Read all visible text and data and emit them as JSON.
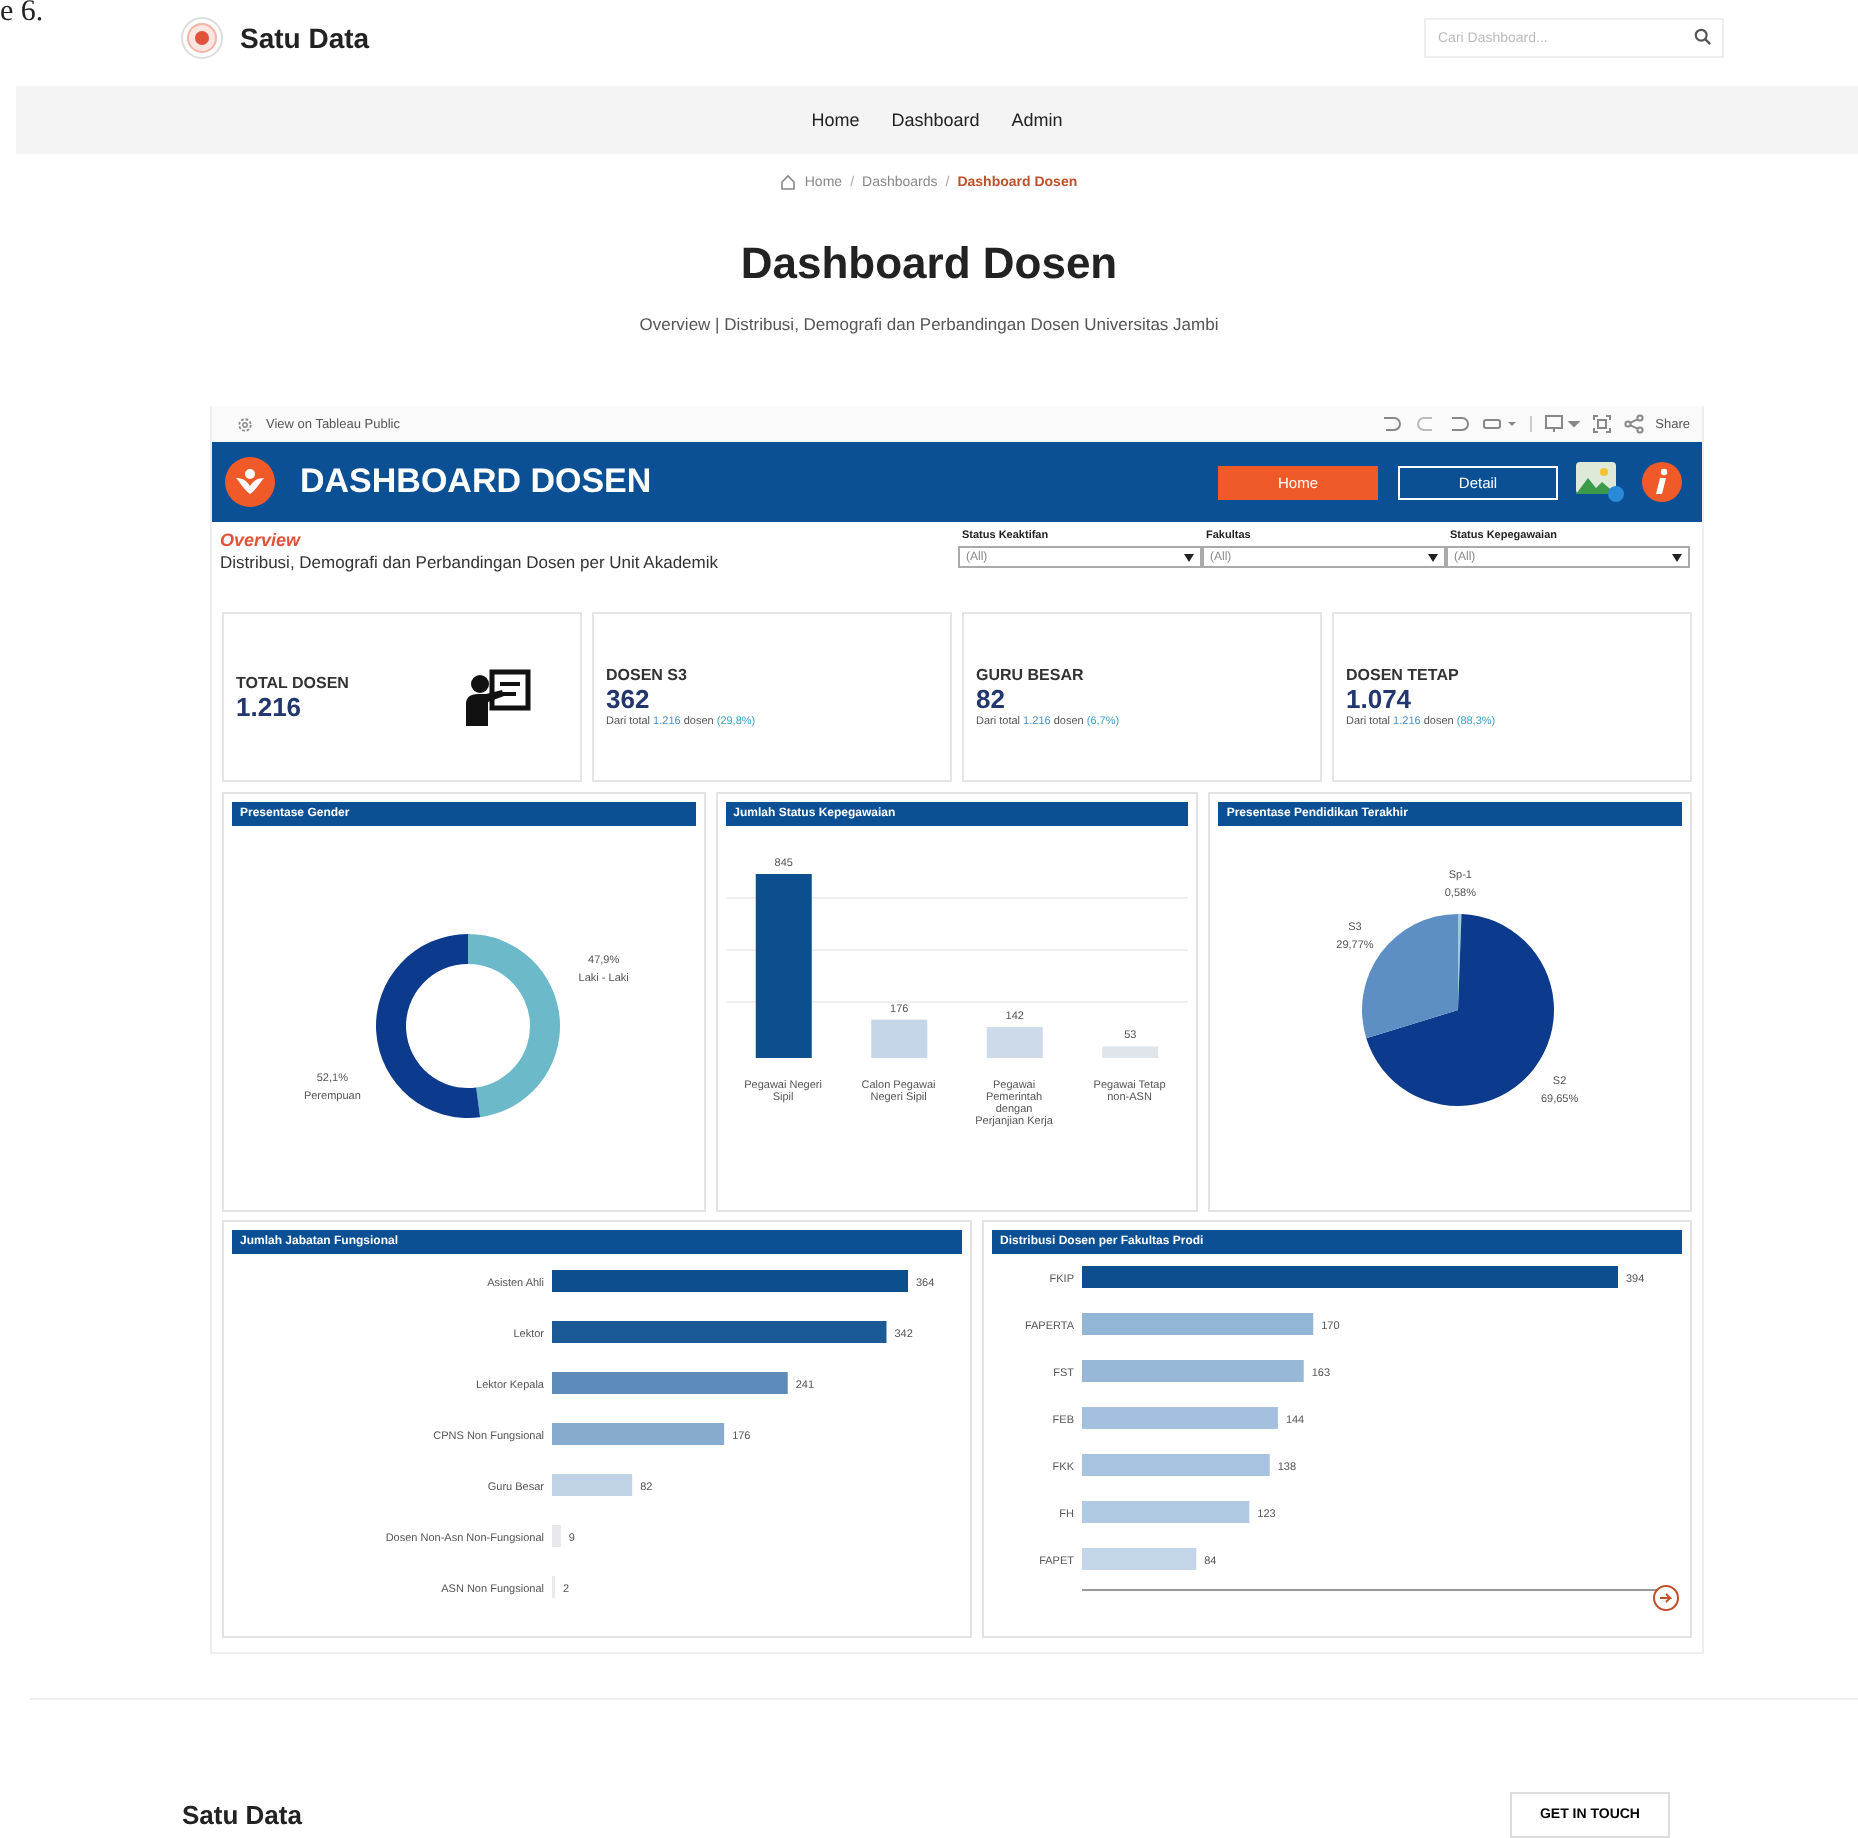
{
  "corner_text": "e 6.",
  "site": {
    "name": "Satu Data",
    "search": {
      "placeholder": "Cari Dashboard..."
    }
  },
  "nav": [
    "Home",
    "Dashboard",
    "Admin"
  ],
  "breadcrumb": {
    "separator": "/",
    "items": [
      {
        "label": "Home",
        "current": false
      },
      {
        "label": "Dashboards",
        "current": false
      },
      {
        "label": "Dashboard Dosen",
        "current": true
      }
    ]
  },
  "page": {
    "title": "Dashboard Dosen",
    "subtitle": "Overview | Distribusi, Demografi dan Perbandingan Dosen Universitas Jambi"
  },
  "embed": {
    "toolbar": {
      "view_link": "View on Tableau Public",
      "share": "Share"
    },
    "header": {
      "title": "DASHBOARD DOSEN",
      "buttons": [
        {
          "label": "Home",
          "selected": true
        },
        {
          "label": "Detail",
          "selected": false
        }
      ]
    },
    "overview": {
      "title": "Overview",
      "text": "Distribusi, Demografi dan Perbandingan Dosen per Unit Akademik"
    },
    "filters": [
      {
        "label": "Status Keaktifan",
        "value": "(All)"
      },
      {
        "label": "Fakultas",
        "value": "(All)"
      },
      {
        "label": "Status Kepegawaian",
        "value": "(All)"
      }
    ],
    "kpis": [
      {
        "kind": "icon",
        "title": "TOTAL DOSEN",
        "value": "1.216"
      },
      {
        "kind": "note",
        "title": "DOSEN S3",
        "value": "362",
        "note": {
          "prefix": "Dari total",
          "total": "1.216",
          "middle": "dosen",
          "percent": "(29,8%)"
        }
      },
      {
        "kind": "note",
        "title": "GURU BESAR",
        "value": "82",
        "note": {
          "prefix": "Dari total",
          "total": "1.216",
          "middle": "dosen",
          "percent": "(6,7%)"
        }
      },
      {
        "kind": "note",
        "title": "DOSEN TETAP",
        "value": "1.074",
        "note": {
          "prefix": "Dari total",
          "total": "1.216",
          "middle": "dosen",
          "percent": "(88,3%)"
        }
      }
    ],
    "chart_rows": [
      {
        "panels": [
          {
            "title": "Presentase Gender",
            "chart_data": {
              "type": "donut",
              "categories": [
                "Laki - Laki",
                "Perempuan"
              ],
              "colors": [
                "#6cbac9",
                "#0c3a8c"
              ],
              "values": [
                47.9,
                52.1
              ],
              "value_labels": [
                "47,9%",
                "52,1%"
              ]
            }
          },
          {
            "title": "Jumlah Status Kepegawaian",
            "chart_data": {
              "type": "bar",
              "orientation": "vertical",
              "categories": [
                "Pegawai Negeri Sipil",
                "Calon Pegawai Negeri Sipil",
                "Pegawai Pemerintah dengan Perjanjian Kerja",
                "Pegawai Tetap non-ASN"
              ],
              "values": [
                845,
                176,
                142,
                53
              ],
              "data_labels": true
            }
          },
          {
            "title": "Presentase Pendidikan Terakhir",
            "chart_data": {
              "type": "pie",
              "categories": [
                "Sp-1",
                "S2",
                "S3"
              ],
              "colors": [
                "#9ecae1",
                "#0c3a8c",
                "#5d8fc4"
              ],
              "values": [
                0.58,
                69.65,
                29.77
              ],
              "value_labels": [
                "0,58%",
                "69,65%",
                "29,77%"
              ]
            }
          }
        ]
      },
      {
        "panels": [
          {
            "title": "Jumlah Jabatan Fungsional",
            "chart_data": {
              "type": "bar",
              "orientation": "horizontal",
              "categories": [
                "Asisten Ahli",
                "Lektor",
                "Lektor Kepala",
                "CPNS Non Fungsional",
                "Guru Besar",
                "Dosen Non-Asn Non-Fungsional",
                "ASN Non Fungsional"
              ],
              "values": [
                364,
                342,
                241,
                176,
                82,
                9,
                2
              ],
              "data_labels": true
            }
          },
          {
            "title": "Distribusi Dosen per Fakultas Prodi",
            "chart_data": {
              "type": "bar",
              "orientation": "horizontal",
              "categories": [
                "FKIP",
                "FAPERTA",
                "FST",
                "FEB",
                "FKK",
                "FH",
                "FAPET"
              ],
              "values": [
                394,
                170,
                163,
                144,
                138,
                123,
                84
              ],
              "data_labels": true
            }
          }
        ]
      }
    ]
  },
  "footer": {
    "name": "Satu Data",
    "button": "GET IN TOUCH"
  }
}
